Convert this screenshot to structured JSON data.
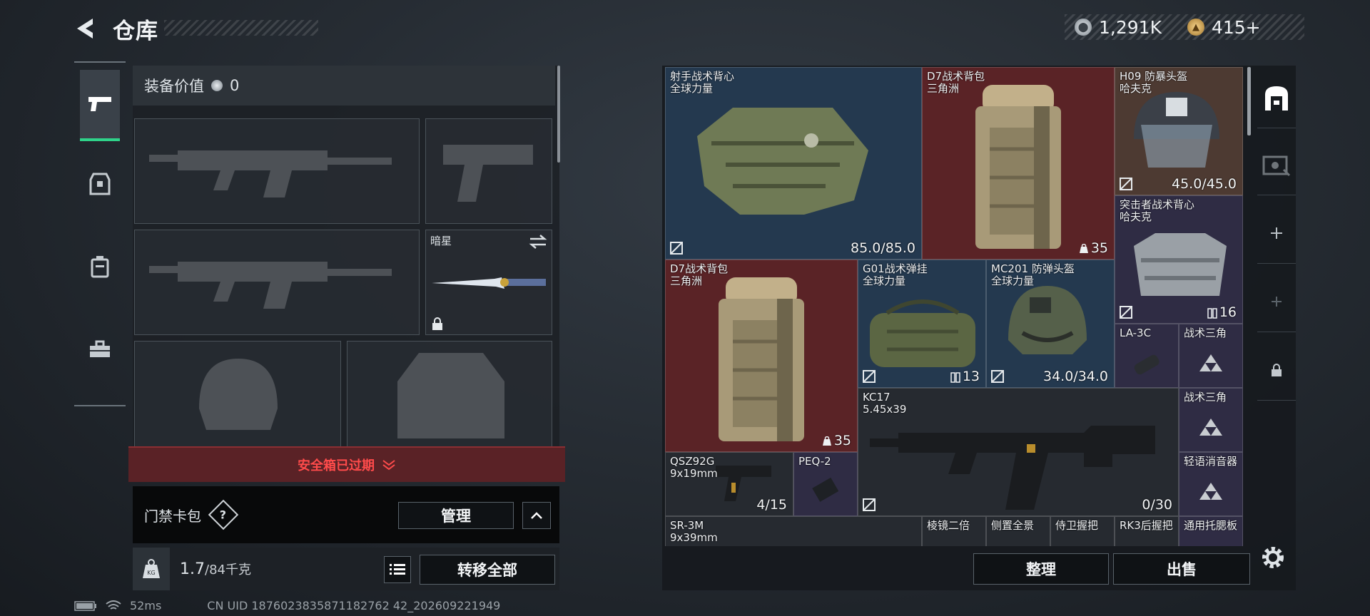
{
  "header": {
    "title": "仓库",
    "currency_1": "1,291K",
    "currency_2": "415+"
  },
  "rail": {
    "tabs": [
      "pistol-icon",
      "armor-icon",
      "backpack-icon",
      "case-icon"
    ]
  },
  "left": {
    "equipment_value_label": "装备价值",
    "equipment_value": "0",
    "knife_slot_name": "暗星",
    "safe_expired": "安全箱已过期",
    "card_pack_label": "门禁卡包",
    "help_label": "?",
    "manage_button": "管理",
    "weight_current": "1.7",
    "weight_capacity": "/84千克",
    "transfer_all_button": "转移全部"
  },
  "status": {
    "ping": "52ms",
    "uid": "CN UID 1876023835871182762 42_202609221949"
  },
  "grid": {
    "items": [
      {
        "name": "射手战术背心",
        "sub": "全球力量",
        "value": "85.0/85.0",
        "color": "blue"
      },
      {
        "name": "D7战术背包",
        "sub": "三角洲",
        "value": "35",
        "color": "red"
      },
      {
        "name": "H09 防暴头盔",
        "sub": "哈夫克",
        "value": "45.0/45.0",
        "color": "brown"
      },
      {
        "name": "突击者战术背心",
        "sub": "哈夫克",
        "value": "16",
        "color": "purple"
      },
      {
        "name": "D7战术背包",
        "sub": "三角洲",
        "value": "35",
        "color": "red"
      },
      {
        "name": "G01战术弹挂",
        "sub": "全球力量",
        "value": "13",
        "color": "blue"
      },
      {
        "name": "MC201 防弹头盔",
        "sub": "全球力量",
        "value": "34.0/34.0",
        "color": "blue"
      },
      {
        "name": "LA-3C",
        "sub": "",
        "value": "",
        "color": "purple"
      },
      {
        "name": "战术三角",
        "sub": "",
        "value": "",
        "color": "purple"
      },
      {
        "name": "KC17",
        "sub": "5.45x39",
        "value": "0/30",
        "color": "dark"
      },
      {
        "name": "战术三角",
        "sub": "",
        "value": "",
        "color": "purple"
      },
      {
        "name": "轻语消音器",
        "sub": "",
        "value": "",
        "color": "purple"
      },
      {
        "name": "QSZ92G",
        "sub": "9x19mm",
        "value": "4/15",
        "color": "dark"
      },
      {
        "name": "PEQ-2",
        "sub": "",
        "value": "",
        "color": "purple"
      },
      {
        "name": "SR-3M",
        "sub": "9x39mm",
        "value": "",
        "color": "dark"
      },
      {
        "name": "棱镜二倍",
        "sub": "",
        "value": "",
        "color": "dark"
      },
      {
        "name": "侧置全景",
        "sub": "",
        "value": "",
        "color": "dark"
      },
      {
        "name": "侍卫握把",
        "sub": "",
        "value": "",
        "color": "dark"
      },
      {
        "name": "RK3后握把",
        "sub": "",
        "value": "",
        "color": "dark"
      },
      {
        "name": "通用托腮板",
        "sub": "",
        "value": "",
        "color": "purple"
      }
    ]
  },
  "actions": {
    "sort_button": "整理",
    "sell_button": "出售"
  }
}
